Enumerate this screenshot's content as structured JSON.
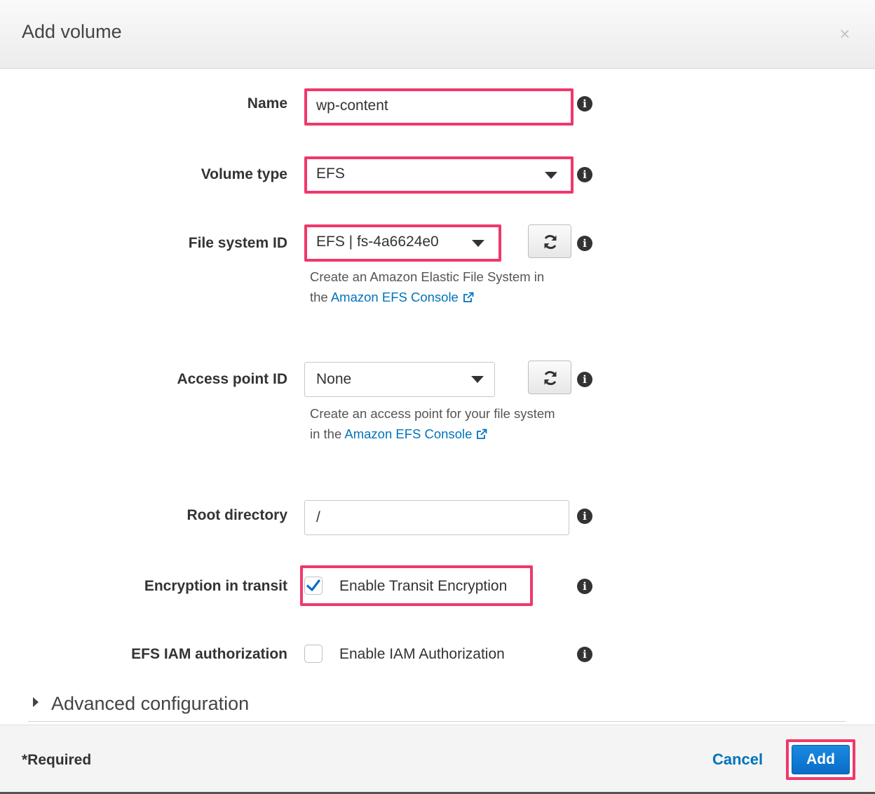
{
  "header": {
    "title": "Add volume",
    "close_glyph": "×"
  },
  "form": {
    "name": {
      "label": "Name",
      "value": "wp-content"
    },
    "volume_type": {
      "label": "Volume type",
      "value": "EFS"
    },
    "file_system_id": {
      "label": "File system ID",
      "value": "EFS | fs-4a6624e0",
      "helper_line1": "Create an Amazon Elastic File System in",
      "helper_prefix": "the",
      "helper_link": "Amazon EFS Console"
    },
    "access_point_id": {
      "label": "Access point ID",
      "value": "None",
      "helper_line1": "Create an access point for your file system",
      "helper_prefix": "in the",
      "helper_link": "Amazon EFS Console"
    },
    "root_directory": {
      "label": "Root directory",
      "value": "/"
    },
    "encryption": {
      "label": "Encryption in transit",
      "option": "Enable Transit Encryption",
      "checked": true
    },
    "iam": {
      "label": "EFS IAM authorization",
      "option": "Enable IAM Authorization",
      "checked": false
    },
    "info_glyph": "i"
  },
  "advanced": {
    "label": "Advanced configuration"
  },
  "footer": {
    "required": "*Required",
    "cancel": "Cancel",
    "add": "Add"
  },
  "colors": {
    "highlight": "#f0386b",
    "link": "#0073bb",
    "primary": "#0a6cc8"
  },
  "icons": [
    "close-icon",
    "info-icon",
    "caret-down-icon",
    "refresh-icon",
    "external-link-icon",
    "checkmark-icon",
    "triangle-right-icon"
  ]
}
